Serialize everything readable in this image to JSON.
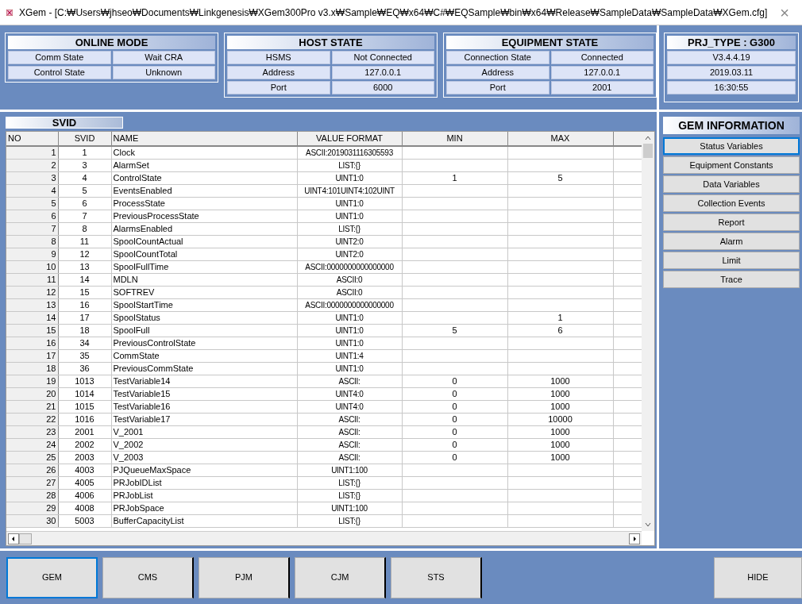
{
  "window": {
    "title": "XGem - [C:₩Users₩jhseo₩Documents₩Linkgenesis₩XGem300Pro v3.x₩Sample₩EQ₩x64₩C#₩EQSample₩bin₩x64₩Release₩SampleData₩SampleData₩XGem.cfg]",
    "close": "×"
  },
  "status_panels": [
    {
      "title": "ONLINE MODE",
      "rows": [
        [
          "Comm State",
          "Wait CRA"
        ],
        [
          "Control State",
          "Unknown"
        ]
      ]
    },
    {
      "title": "HOST STATE",
      "rows": [
        [
          "HSMS",
          "Not Connected"
        ],
        [
          "Address",
          "127.0.0.1"
        ],
        [
          "Port",
          "6000"
        ]
      ]
    },
    {
      "title": "EQUIPMENT STATE",
      "rows": [
        [
          "Connection State",
          "Connected"
        ],
        [
          "Address",
          "127.0.0.1"
        ],
        [
          "Port",
          "2001"
        ]
      ]
    }
  ],
  "project_panel": {
    "title": "PRJ_TYPE : G300",
    "lines": [
      "V3.4.4.19",
      "2019.03.11",
      "16:30:55"
    ]
  },
  "table_tab": "SVID",
  "table": {
    "columns": [
      "NO",
      "SVID",
      "NAME",
      "VALUE FORMAT",
      "MIN",
      "MAX"
    ],
    "rows": [
      [
        "1",
        "1",
        "Clock",
        "ASCII:2019031116305593",
        "",
        ""
      ],
      [
        "2",
        "3",
        "AlarmSet",
        "LIST:{}",
        "",
        ""
      ],
      [
        "3",
        "4",
        "ControlState",
        "UINT1:0",
        "1",
        "5"
      ],
      [
        "4",
        "5",
        "EventsEnabled",
        "UINT4:101UINT4:102UINT",
        "",
        ""
      ],
      [
        "5",
        "6",
        "ProcessState",
        "UINT1:0",
        "",
        ""
      ],
      [
        "6",
        "7",
        "PreviousProcessState",
        "UINT1:0",
        "",
        ""
      ],
      [
        "7",
        "8",
        "AlarmsEnabled",
        "LIST:{}",
        "",
        ""
      ],
      [
        "8",
        "11",
        "SpoolCountActual",
        "UINT2:0",
        "",
        ""
      ],
      [
        "9",
        "12",
        "SpoolCountTotal",
        "UINT2:0",
        "",
        ""
      ],
      [
        "10",
        "13",
        "SpoolFullTime",
        "ASCII:0000000000000000",
        "",
        ""
      ],
      [
        "11",
        "14",
        "MDLN",
        "ASCII:0",
        "",
        ""
      ],
      [
        "12",
        "15",
        "SOFTREV",
        "ASCII:0",
        "",
        ""
      ],
      [
        "13",
        "16",
        "SpoolStartTime",
        "ASCII:0000000000000000",
        "",
        ""
      ],
      [
        "14",
        "17",
        "SpoolStatus",
        "UINT1:0",
        "",
        "1"
      ],
      [
        "15",
        "18",
        "SpoolFull",
        "UINT1:0",
        "5",
        "6"
      ],
      [
        "16",
        "34",
        "PreviousControlState",
        "UINT1:0",
        "",
        ""
      ],
      [
        "17",
        "35",
        "CommState",
        "UINT1:4",
        "",
        ""
      ],
      [
        "18",
        "36",
        "PreviousCommState",
        "UINT1:0",
        "",
        ""
      ],
      [
        "19",
        "1013",
        "TestVariable14",
        "ASCII:",
        "0",
        "1000"
      ],
      [
        "20",
        "1014",
        "TestVariable15",
        "UINT4:0",
        "0",
        "1000"
      ],
      [
        "21",
        "1015",
        "TestVariable16",
        "UINT4:0",
        "0",
        "1000"
      ],
      [
        "22",
        "1016",
        "TestVariable17",
        "ASCII:",
        "0",
        "10000"
      ],
      [
        "23",
        "2001",
        "V_2001",
        "ASCII:",
        "0",
        "1000"
      ],
      [
        "24",
        "2002",
        "V_2002",
        "ASCII:",
        "0",
        "1000"
      ],
      [
        "25",
        "2003",
        "V_2003",
        "ASCII:",
        "0",
        "1000"
      ],
      [
        "26",
        "4003",
        "PJQueueMaxSpace",
        "UINT1:100",
        "",
        ""
      ],
      [
        "27",
        "4005",
        "PRJobIDList",
        "LIST:{}",
        "",
        ""
      ],
      [
        "28",
        "4006",
        "PRJobList",
        "LIST:{}",
        "",
        ""
      ],
      [
        "29",
        "4008",
        "PRJobSpace",
        "UINT1:100",
        "",
        ""
      ],
      [
        "30",
        "5003",
        "BufferCapacityList",
        "LIST:{}",
        "",
        ""
      ]
    ]
  },
  "gem_information": {
    "title": "GEM INFORMATION",
    "items": [
      {
        "label": "Status Variables",
        "selected": true
      },
      {
        "label": "Equipment Constants",
        "selected": false
      },
      {
        "label": "Data Variables",
        "selected": false
      },
      {
        "label": "Collection Events",
        "selected": false
      },
      {
        "label": "Report",
        "selected": false
      },
      {
        "label": "Alarm",
        "selected": false
      },
      {
        "label": "Limit",
        "selected": false
      },
      {
        "label": "Trace",
        "selected": false
      }
    ]
  },
  "bottom_tabs": [
    {
      "label": "GEM",
      "selected": true
    },
    {
      "label": "CMS",
      "selected": false
    },
    {
      "label": "PJM",
      "selected": false
    },
    {
      "label": "CJM",
      "selected": false
    },
    {
      "label": "STS",
      "selected": false
    }
  ],
  "hide_button": "HIDE"
}
